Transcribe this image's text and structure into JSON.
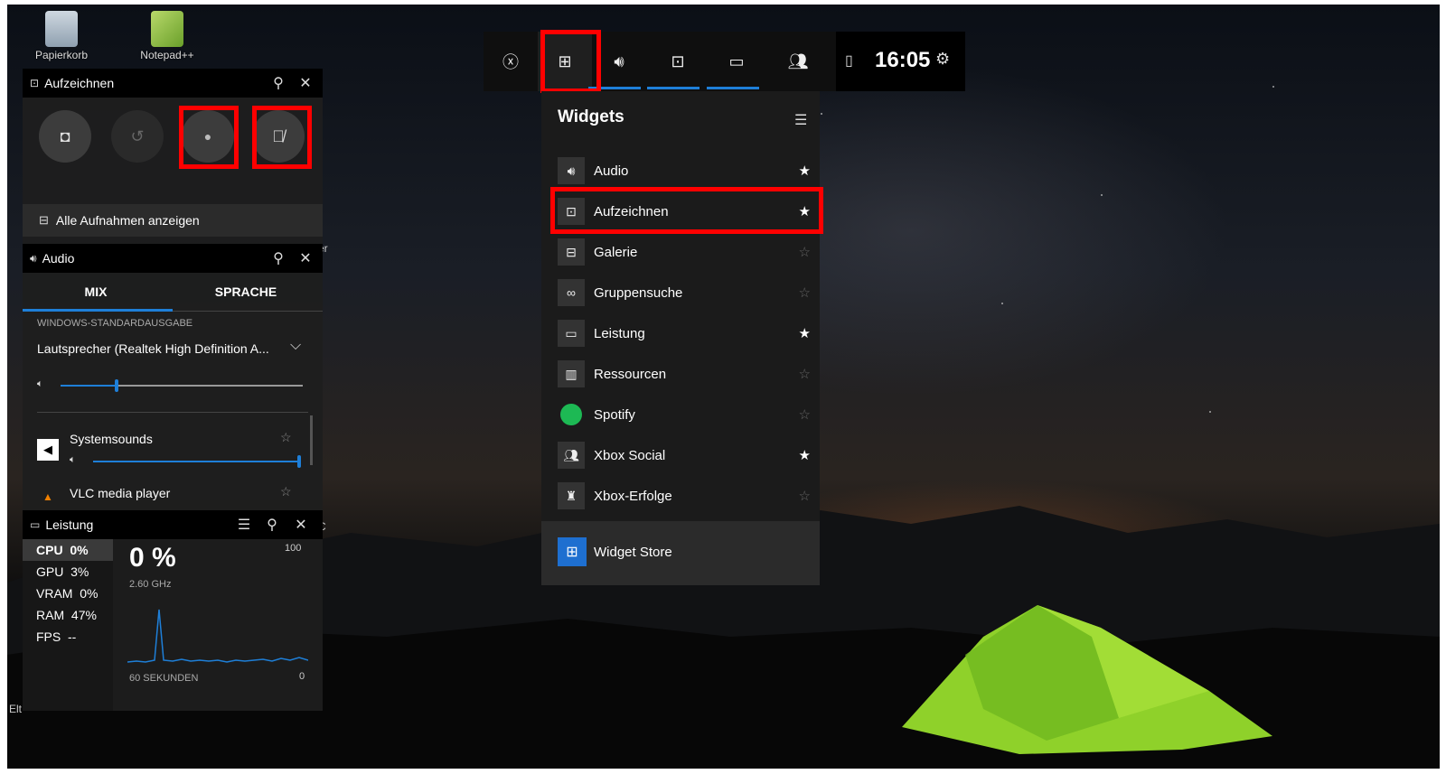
{
  "desktop": {
    "icons": [
      {
        "label": "Papierkorb"
      },
      {
        "label": "Notepad++"
      }
    ],
    "fragments": [
      "er",
      "Elt",
      "C"
    ]
  },
  "record_panel": {
    "title": "Aufzeichnen",
    "show_all": "Alle Aufnahmen anzeigen",
    "highlight_color": "#ff0000"
  },
  "audio_panel": {
    "title": "Audio",
    "tabs": [
      "MIX",
      "SPRACHE"
    ],
    "output_header": "WINDOWS-STANDARDAUSGABE",
    "device": "Lautsprecher (Realtek High Definition A...",
    "master_level": 0.23,
    "apps": [
      {
        "name": "Systemsounds",
        "level": 1.0
      },
      {
        "name": "VLC media player"
      }
    ]
  },
  "performance_panel": {
    "title": "Leistung",
    "metrics": [
      {
        "name": "CPU",
        "value": "0%"
      },
      {
        "name": "GPU",
        "value": "3%"
      },
      {
        "name": "VRAM",
        "value": "0%"
      },
      {
        "name": "RAM",
        "value": "47%"
      },
      {
        "name": "FPS",
        "value": "--"
      }
    ],
    "big_value": "0 %",
    "frequency": "2.60 GHz",
    "axis_max": "100",
    "axis_min": "0",
    "time_label": "60 SEKUNDEN",
    "graph_color": "#1e7fd8"
  },
  "top_bar": {
    "time": "16:05",
    "accent": "#1e7fd8"
  },
  "widgets_menu": {
    "title": "Widgets",
    "items": [
      {
        "label": "Audio",
        "icon": "speaker-icon",
        "favorite": true
      },
      {
        "label": "Aufzeichnen",
        "icon": "record-icon",
        "favorite": true
      },
      {
        "label": "Galerie",
        "icon": "gallery-icon",
        "favorite": false
      },
      {
        "label": "Gruppensuche",
        "icon": "binoculars-icon",
        "favorite": false
      },
      {
        "label": "Leistung",
        "icon": "performance-icon",
        "favorite": true
      },
      {
        "label": "Ressourcen",
        "icon": "resources-icon",
        "favorite": false
      },
      {
        "label": "Spotify",
        "icon": "spotify-icon",
        "favorite": false
      },
      {
        "label": "Xbox Social",
        "icon": "social-icon",
        "favorite": true
      },
      {
        "label": "Xbox-Erfolge",
        "icon": "trophy-icon",
        "favorite": false
      }
    ],
    "store_label": "Widget Store"
  }
}
